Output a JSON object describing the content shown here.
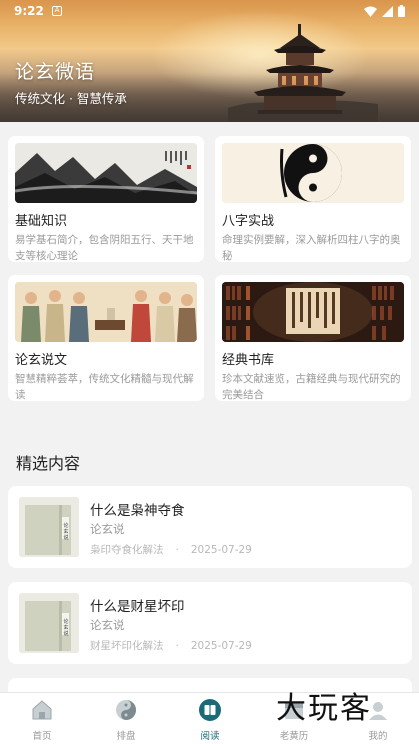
{
  "status_bar": {
    "time": "9:22"
  },
  "hero": {
    "title": "论玄微语",
    "subtitle": "传统文化 · 智慧传承"
  },
  "grid": [
    {
      "title": "基础知识",
      "desc": "易学基石简介，包含阴阳五行、天干地支等核心理论"
    },
    {
      "title": "八字实战",
      "desc": "命理实例要解，深入解析四柱八字的奥秘"
    },
    {
      "title": "论玄说文",
      "desc": "智慧精粹荟萃，传统文化精髓与现代解读"
    },
    {
      "title": "经典书库",
      "desc": "珍本文献速览，古籍经典与现代研究的完美结合"
    }
  ],
  "section": {
    "title": "精选内容"
  },
  "featured": [
    {
      "title": "什么是枭神夺食",
      "author": "论玄说",
      "tag": "枭印夺食化解法",
      "date": "2025-07-29",
      "book_label": "论玄说"
    },
    {
      "title": "什么是财星坏印",
      "author": "论玄说",
      "tag": "财星坏印化解法",
      "date": "2025-07-29",
      "book_label": "论玄说"
    }
  ],
  "nav": [
    {
      "label": "首页",
      "icon": "home-icon"
    },
    {
      "label": "排盘",
      "icon": "yinyang-icon"
    },
    {
      "label": "阅读",
      "icon": "book-icon",
      "active": true
    },
    {
      "label": "老黄历",
      "icon": "calendar-icon"
    },
    {
      "label": "我的",
      "icon": "profile-icon"
    }
  ],
  "watermark": "大玩客",
  "colors": {
    "accent": "#1a6a78",
    "muted": "#9a9a9a",
    "background": "#f2f2f2"
  }
}
